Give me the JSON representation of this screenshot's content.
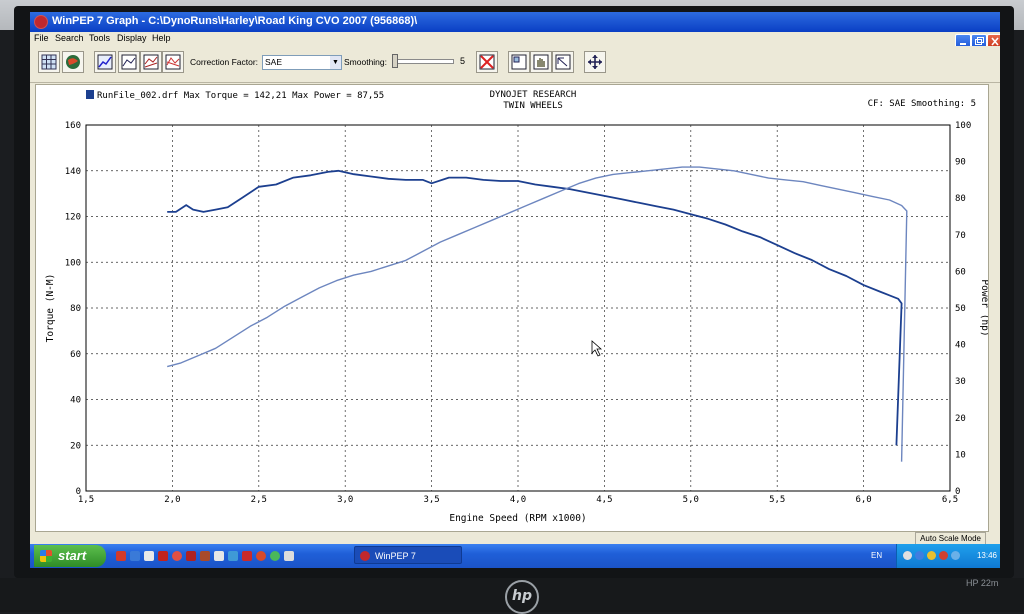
{
  "window": {
    "app_name": "WinPEP 7",
    "title": "WinPEP 7    Graph - C:\\DynoRuns\\Harley\\Road King CVO 2007 (956868)\\"
  },
  "menu": [
    "File",
    "Search",
    "Tools",
    "Display",
    "Help"
  ],
  "toolbar": {
    "correction_label": "Correction Factor:",
    "correction_value": "SAE",
    "smoothing_label": "Smoothing:",
    "smoothing_value": "5",
    "icons": [
      "grid-icon",
      "globe-icon",
      "graph-3d-icon",
      "graph-icon",
      "graph-2-icon",
      "graph-3-icon",
      "clear-icon",
      "zoom-in-icon",
      "hand-icon",
      "cursor-graph-icon",
      "move-icon"
    ]
  },
  "graph": {
    "run_legend": "RunFile_002.drf Max Torque = 142,21 Max Power = 87,55",
    "header1": "DYNOJET RESEARCH",
    "header2": "TWIN WHEELS",
    "cf_label": "CF: SAE  Smoothing: 5"
  },
  "status": {
    "auto_scale": "Auto Scale Mode"
  },
  "taskbar": {
    "start": "start",
    "task": "WinPEP 7",
    "lang": "EN",
    "clock": "13:46"
  },
  "monitor": {
    "model": "HP 22m",
    "logo": "hp"
  },
  "colors": {
    "torque": "#1c3f8f",
    "power": "#6d86bf",
    "grid": "#333333",
    "titlebar": "#0a3fc4"
  },
  "chart_data": {
    "type": "line",
    "xlabel": "Engine Speed (RPM x1000)",
    "ylabel_left": "Torque (N-M)",
    "ylabel_right": "Power (hp)",
    "xlim": [
      1.5,
      6.5
    ],
    "ylim_left": [
      0,
      160
    ],
    "ylim_right": [
      0,
      100
    ],
    "xticks": [
      "1,5",
      "2,0",
      "2,5",
      "3,0",
      "3,5",
      "4,0",
      "4,5",
      "5,0",
      "5,5",
      "6,0",
      "6,5"
    ],
    "yticks_left": [
      "0",
      "20",
      "40",
      "60",
      "80",
      "100",
      "120",
      "140",
      "160"
    ],
    "yticks_right": [
      "0",
      "10",
      "20",
      "30",
      "40",
      "50",
      "60",
      "70",
      "80",
      "90",
      "100"
    ],
    "grid": true,
    "series": [
      {
        "name": "Torque",
        "axis": "left",
        "x": [
          1.97,
          2.02,
          2.08,
          2.12,
          2.18,
          2.25,
          2.32,
          2.4,
          2.5,
          2.6,
          2.7,
          2.8,
          2.9,
          2.96,
          3.05,
          3.15,
          3.25,
          3.35,
          3.45,
          3.5,
          3.6,
          3.7,
          3.8,
          3.9,
          4.0,
          4.1,
          4.2,
          4.3,
          4.4,
          4.5,
          4.6,
          4.7,
          4.8,
          4.9,
          5.0,
          5.1,
          5.2,
          5.3,
          5.4,
          5.5,
          5.6,
          5.7,
          5.8,
          5.9,
          6.0,
          6.1,
          6.2,
          6.22,
          6.19
        ],
        "y": [
          122,
          122,
          125,
          123,
          122,
          123,
          124,
          128,
          133,
          134,
          137,
          138,
          139.5,
          140,
          138.5,
          137.5,
          136.5,
          136,
          136,
          134.5,
          137,
          137,
          136,
          135.5,
          135.5,
          134,
          133,
          132,
          130.5,
          129,
          127.5,
          126,
          124.5,
          123,
          121,
          119,
          116.5,
          113.5,
          111,
          107.5,
          104,
          101,
          97,
          94,
          90,
          87,
          84,
          82,
          20
        ]
      },
      {
        "name": "Power",
        "axis": "right",
        "x": [
          1.97,
          2.05,
          2.15,
          2.25,
          2.35,
          2.45,
          2.55,
          2.65,
          2.75,
          2.85,
          2.95,
          3.05,
          3.15,
          3.25,
          3.35,
          3.45,
          3.55,
          3.65,
          3.75,
          3.85,
          3.95,
          4.05,
          4.15,
          4.25,
          4.35,
          4.45,
          4.55,
          4.65,
          4.75,
          4.85,
          4.95,
          5.05,
          5.15,
          5.25,
          5.35,
          5.45,
          5.55,
          5.65,
          5.75,
          5.85,
          5.95,
          6.05,
          6.15,
          6.22,
          6.25,
          6.22
        ],
        "y": [
          34,
          35,
          37,
          39,
          42,
          45,
          47.5,
          50.5,
          53,
          55.5,
          57.5,
          59,
          60,
          61.5,
          63,
          65.5,
          68,
          70,
          72,
          74,
          76,
          78,
          80,
          82,
          84,
          85.5,
          86.5,
          87,
          87.5,
          88,
          88.5,
          88.5,
          88,
          87.5,
          86.5,
          85.5,
          85,
          84.5,
          83.5,
          82.5,
          81.5,
          80.5,
          79.5,
          78,
          76.5,
          8
        ]
      }
    ]
  }
}
